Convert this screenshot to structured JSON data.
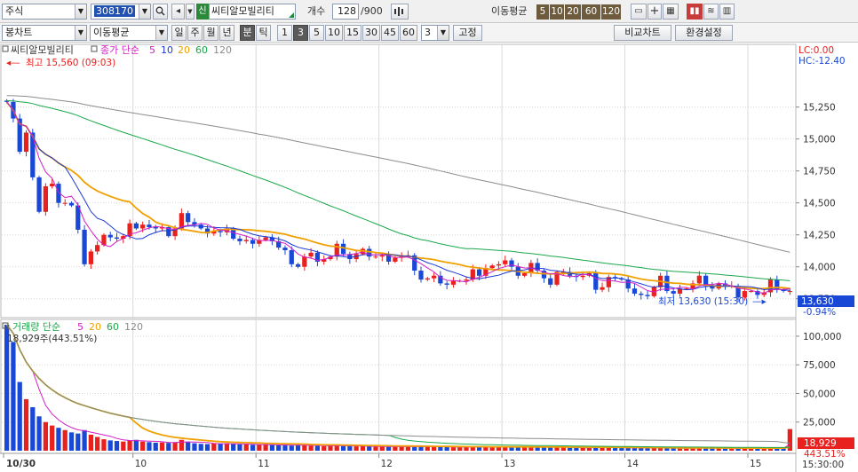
{
  "toolbar1": {
    "market_type": "주식",
    "stock_code": "308170",
    "stock_name_badge": "신",
    "stock_name": "씨티알모빌리티",
    "count_label": "개수",
    "count_value": "128",
    "count_total": "/900",
    "ma_label": "이동평균",
    "ma_periods": [
      "5",
      "10",
      "20",
      "60",
      "120"
    ]
  },
  "toolbar2": {
    "chart_type": "봉차트",
    "indicator": "이동평균",
    "periods": [
      "일",
      "주",
      "월",
      "년",
      "분",
      "틱"
    ],
    "active_period": "분",
    "intervals": [
      "1",
      "3",
      "5",
      "10",
      "15",
      "30",
      "45",
      "60"
    ],
    "active_interval": "3",
    "interval_input": "3",
    "fix_button": "고정",
    "compare_button": "비교차트",
    "settings_button": "환경설정"
  },
  "colors": {
    "up": "#e8201e",
    "down": "#1a48d6",
    "ma5": "#d21ec8",
    "ma10": "#1a3ad8",
    "ma20": "#f0a000",
    "ma60": "#1aa84a",
    "ma120": "#8c8c8c"
  },
  "chart_data": {
    "type": "candlestick",
    "price_panel": {
      "title": "씨티알모빌리티",
      "legend": {
        "label": "종가 단순",
        "periods": [
          "5",
          "10",
          "20",
          "60",
          "120"
        ]
      },
      "high_annotation": "최고 15,560 (09:03)",
      "low_annotation": "최저 13,630 (15:30)",
      "lc_label": "LC:0.00",
      "hc_label": "HC:-12.40",
      "y_ticks": [
        15250,
        15000,
        14750,
        14500,
        14250,
        14000,
        13750
      ],
      "y_tick_labels": [
        "15,250",
        "15,000",
        "14,750",
        "14,500",
        "14,250",
        "14,000",
        "13,750"
      ],
      "ylim": [
        13630,
        15560
      ],
      "current_price": "13,630",
      "current_change": "-0.94%"
    },
    "volume_panel": {
      "legend": {
        "label": "거래량 단순",
        "periods": [
          "5",
          "20",
          "60",
          "120"
        ]
      },
      "last_volume_label": "18,929주(443.51%)",
      "y_ticks": [
        100000,
        75000,
        50000,
        25000
      ],
      "y_tick_labels": [
        "100,000",
        "75,000",
        "50,000",
        "25,000"
      ],
      "ymax": 110000,
      "current_volume": "18,929",
      "current_ratio": "443.51%"
    },
    "x_labels": [
      "10/30",
      "10",
      "11",
      "12",
      "13",
      "14",
      "15"
    ],
    "x_label_bars": [
      0,
      20,
      39,
      58,
      77,
      96,
      115
    ],
    "time_label": "15:30:00",
    "bar_count": 122,
    "candles": {
      "close": [
        15290,
        15160,
        14900,
        15050,
        14700,
        14430,
        14630,
        14650,
        14500,
        14500,
        14480,
        14290,
        14020,
        14120,
        14170,
        14250,
        14230,
        14220,
        14240,
        14340,
        14300,
        14330,
        14310,
        14300,
        14310,
        14240,
        14300,
        14420,
        14350,
        14330,
        14300,
        14260,
        14280,
        14270,
        14300,
        14220,
        14200,
        14210,
        14180,
        14210,
        14230,
        14200,
        14150,
        14130,
        14020,
        14000,
        14080,
        14110,
        14040,
        14060,
        14080,
        14180,
        14100,
        14060,
        14100,
        14140,
        14080,
        14080,
        14090,
        14040,
        14070,
        14090,
        14090,
        13970,
        13900,
        13910,
        13930,
        13870,
        13860,
        13890,
        13890,
        13900,
        13980,
        13930,
        13990,
        14010,
        14020,
        14050,
        14000,
        13930,
        13950,
        14030,
        13970,
        13910,
        13860,
        13960,
        13960,
        13930,
        13920,
        13930,
        13950,
        13820,
        13840,
        13920,
        13910,
        13900,
        13830,
        13790,
        13780,
        13770,
        13840,
        13930,
        13810,
        13790,
        13830,
        13830,
        13870,
        13930,
        13850,
        13830,
        13870,
        13850,
        13850,
        13760,
        13810,
        13810,
        13780,
        13800,
        13900,
        13820,
        13810,
        13810
      ],
      "open": [
        15300,
        15290,
        15160,
        14900,
        15050,
        14700,
        14430,
        14630,
        14650,
        14500,
        14500,
        14480,
        14290,
        14020,
        14120,
        14170,
        14250,
        14230,
        14220,
        14240,
        14340,
        14300,
        14330,
        14310,
        14300,
        14310,
        14240,
        14300,
        14420,
        14350,
        14330,
        14300,
        14260,
        14280,
        14270,
        14300,
        14220,
        14200,
        14210,
        14180,
        14210,
        14230,
        14200,
        14150,
        14130,
        14020,
        14000,
        14080,
        14110,
        14040,
        14060,
        14080,
        14180,
        14100,
        14060,
        14100,
        14140,
        14080,
        14080,
        14090,
        14040,
        14070,
        14090,
        14090,
        13970,
        13900,
        13910,
        13930,
        13870,
        13860,
        13890,
        13890,
        13900,
        13980,
        13930,
        13990,
        14010,
        14020,
        14050,
        14000,
        13930,
        13950,
        14030,
        13970,
        13910,
        13860,
        13960,
        13960,
        13930,
        13920,
        13930,
        13950,
        13820,
        13840,
        13920,
        13910,
        13900,
        13830,
        13790,
        13780,
        13770,
        13840,
        13930,
        13810,
        13790,
        13830,
        13830,
        13870,
        13930,
        13850,
        13830,
        13870,
        13850,
        13850,
        13760,
        13810,
        13810,
        13780,
        13800,
        13900,
        13820,
        13810
      ],
      "volume": [
        110000,
        95000,
        60000,
        45000,
        38000,
        30000,
        25000,
        22000,
        20000,
        18000,
        16000,
        15000,
        18000,
        14000,
        12000,
        10000,
        9000,
        8500,
        8000,
        9000,
        9500,
        8000,
        7500,
        7000,
        7200,
        6800,
        7000,
        9500,
        7800,
        6500,
        6000,
        5800,
        6200,
        6000,
        6500,
        5800,
        5500,
        5400,
        5200,
        5000,
        5600,
        5000,
        4800,
        4600,
        4500,
        5200,
        4800,
        4400,
        4200,
        4000,
        4300,
        5000,
        4100,
        3900,
        3800,
        4000,
        3700,
        3600,
        3500,
        3400,
        3600,
        3800,
        3500,
        3300,
        4200,
        3500,
        3400,
        3200,
        3100,
        3000,
        3100,
        2900,
        3800,
        3000,
        3500,
        3400,
        3200,
        3100,
        3000,
        3200,
        3000,
        3500,
        3000,
        3200,
        3600,
        2800,
        2700,
        2600,
        2500,
        2600,
        2400,
        3500,
        2600,
        2800,
        2500,
        2400,
        2600,
        2300,
        2200,
        2100,
        2800,
        2600,
        2200,
        2100,
        2000,
        2100,
        2300,
        3000,
        2200,
        2100,
        2000,
        2200,
        2000,
        2800,
        2100,
        2000,
        2200,
        1900,
        2500,
        2200,
        2100,
        18929
      ]
    }
  }
}
